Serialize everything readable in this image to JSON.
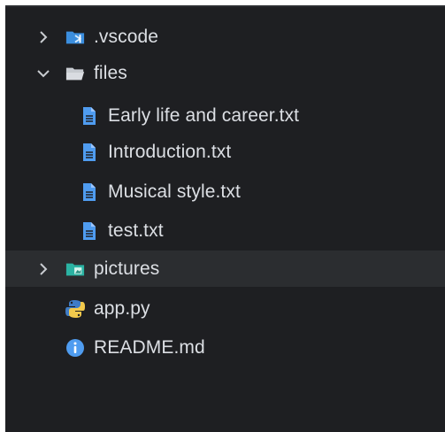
{
  "explorer": {
    "items": [
      {
        "label": ".vscode",
        "icon": "vscode-folder-icon",
        "chevron": "chevron-right-icon"
      },
      {
        "label": "files",
        "icon": "folder-open-icon",
        "chevron": "chevron-down-icon"
      },
      {
        "label": "Early life and career.txt",
        "icon": "text-file-icon"
      },
      {
        "label": "Introduction.txt",
        "icon": "text-file-icon"
      },
      {
        "label": "Musical style.txt",
        "icon": "text-file-icon"
      },
      {
        "label": "test.txt",
        "icon": "text-file-icon"
      },
      {
        "label": "pictures",
        "icon": "images-folder-icon",
        "chevron": "chevron-right-icon"
      },
      {
        "label": "app.py",
        "icon": "python-icon"
      },
      {
        "label": "README.md",
        "icon": "info-icon"
      }
    ]
  },
  "colors": {
    "background": "#1e1f22",
    "hover_row": "#2b2d30",
    "text": "#dcdfe4",
    "file_blue": "#4f9cf0",
    "folder_teal": "#2bb3a3",
    "python_blue": "#3f7cc6",
    "python_yellow": "#f2c94c"
  }
}
